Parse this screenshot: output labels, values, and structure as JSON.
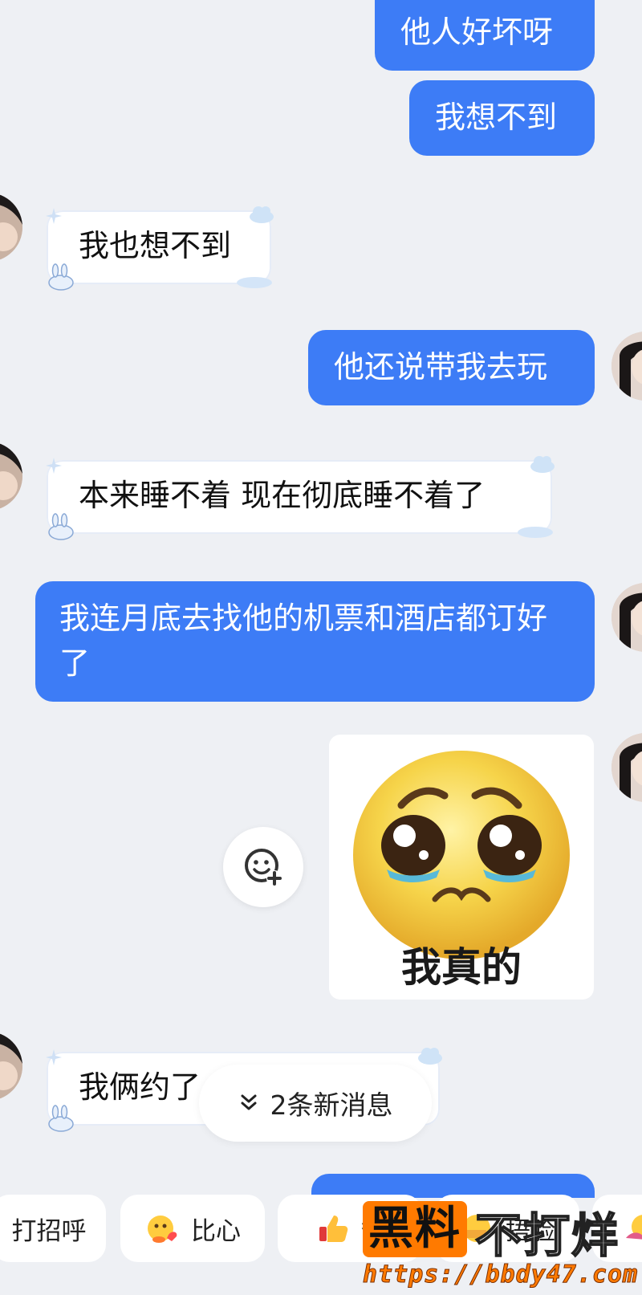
{
  "messages": {
    "m1": "他人好坏呀",
    "m2": "我想不到",
    "m3": "我也想不到",
    "m4": "他还说带我去玩",
    "m5": "本来睡不着 现在彻底睡不着了",
    "m6": "我连月底去找他的机票和酒店都订好了",
    "m7": "我俩约了",
    "sticker_caption": "我真的"
  },
  "new_messages": {
    "label": "2条新消息",
    "icon": "double-chevron-down-icon"
  },
  "quick_replies": [
    {
      "label": "打招呼"
    },
    {
      "label": "比心",
      "icon": "heart-gesture-icon"
    },
    {
      "label": "赞",
      "icon": "thumbs-up-icon"
    },
    {
      "label": "捂脸",
      "icon": "facepalm-icon"
    }
  ],
  "watermark": {
    "brand_a": "黑料",
    "brand_b": "不打烊",
    "url": "https://bbdy47.com"
  },
  "colors": {
    "outgoing_bubble": "#3d7cf6",
    "incoming_bubble": "#ffffff",
    "background": "#eef0f4",
    "watermark_orange": "#ff7a00"
  }
}
